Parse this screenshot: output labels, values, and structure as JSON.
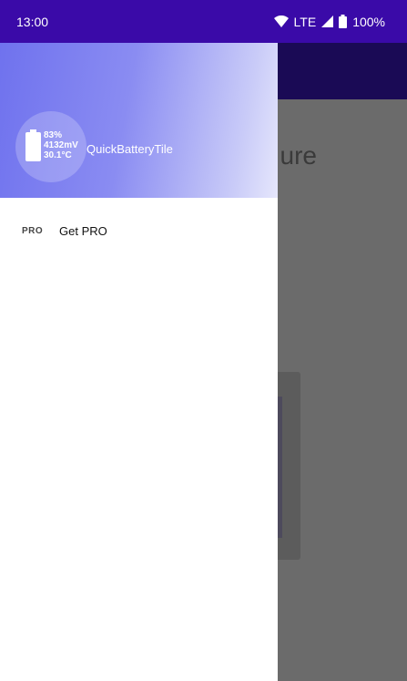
{
  "status_bar": {
    "time": "13:00",
    "network": "LTE",
    "battery": "100%",
    "icons": [
      "wifi-icon",
      "signal-icon",
      "battery-icon"
    ]
  },
  "background": {
    "heading_fragment": "ure"
  },
  "drawer": {
    "header": {
      "battery_percent": "83%",
      "voltage": "4132mV",
      "temperature": "30.1°C",
      "app_name": "QuickBatteryTile"
    },
    "menu": [
      {
        "icon": "PRO",
        "label": "Get PRO"
      }
    ]
  },
  "colors": {
    "status_bar": "#3a0aa8",
    "header_gradient_start": "#6f72ee",
    "header_gradient_end": "#e6e7fc",
    "scrim": "#6a6a6a"
  }
}
